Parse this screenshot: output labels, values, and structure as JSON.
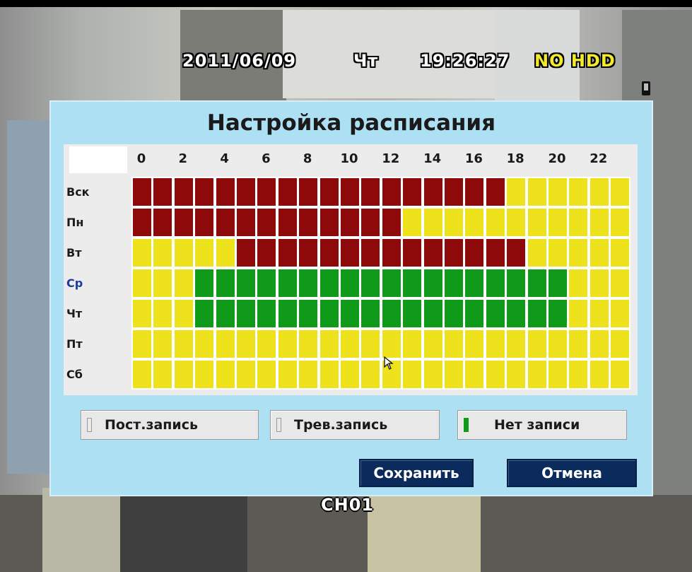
{
  "osd": {
    "date": "2011/06/09",
    "weekday": "Чт",
    "time": "19:26:27",
    "hdd_status": "NO HDD",
    "channel": "CH01"
  },
  "dialog": {
    "title": "Настройка расписания",
    "hour_labels": [
      "0",
      "2",
      "4",
      "6",
      "8",
      "10",
      "12",
      "14",
      "16",
      "18",
      "20",
      "22"
    ],
    "days": [
      {
        "label": "Вск",
        "color": "#1a1a1a",
        "schedule": "RRRRRRRRRRRRRRRRRRYYYYYY"
      },
      {
        "label": "Пн",
        "color": "#1a1a1a",
        "schedule": "RRRRRRRRRRRRRYYYYYYYYYYY"
      },
      {
        "label": "Вт",
        "color": "#1a1a1a",
        "schedule": "YYYYYRRRRRRRRRRRRRRYYYYY"
      },
      {
        "label": "Ср",
        "color": "#1b3c9c",
        "schedule": "YYYGGGGGGGGGGGGGGGGGGYYY"
      },
      {
        "label": "Чт",
        "color": "#1a1a1a",
        "schedule": "YYYGGGGGGGGGGGGGGGGGGYYY"
      },
      {
        "label": "Пт",
        "color": "#1a1a1a",
        "schedule": "YYYYYYYYYYYYYYYYYYYYYYYY"
      },
      {
        "label": "Сб",
        "color": "#1a1a1a",
        "schedule": "YYYYYYYYYYYYYYYYYYYYYYYY"
      }
    ],
    "legend": [
      {
        "key": "Y",
        "label": "Пост.запись",
        "color": "#eee21d"
      },
      {
        "key": "R",
        "label": "Трев.запись",
        "color": "#8e0a0a"
      },
      {
        "key": "G",
        "label": "Нет записи",
        "color": "#0f9a1a"
      }
    ],
    "save_label": "Сохранить",
    "cancel_label": "Отмена"
  },
  "colors": {
    "dialog_bg": "#aee0f4",
    "grid_bg": "#ececec",
    "button_blue": "#0b2b5c",
    "osd_highlight": "#f2ea2a"
  }
}
